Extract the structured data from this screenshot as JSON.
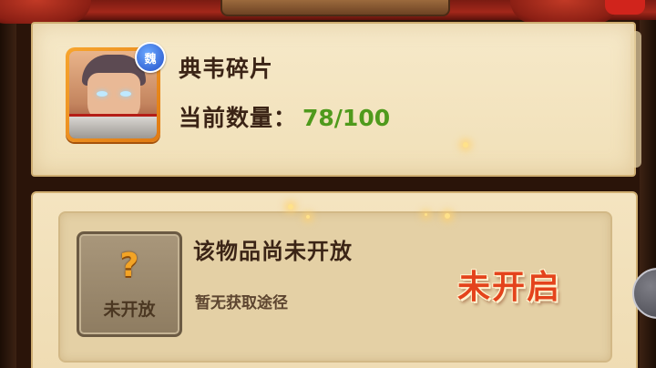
{
  "item": {
    "name": "典韦碎片",
    "count_label": "当前数量：",
    "count_value": "78/100",
    "faction_badge": "魏",
    "portrait_icon": "hero-portrait-icon"
  },
  "source": {
    "title": "该物品尚未开放",
    "subtitle": "暂无获取途径",
    "slot_text": "未开放",
    "slot_icon": "question-mark-icon",
    "status": "未开启"
  },
  "colors": {
    "count_value": "#4f9a1c",
    "status": "#e4431c",
    "badge": "#2552c9"
  }
}
